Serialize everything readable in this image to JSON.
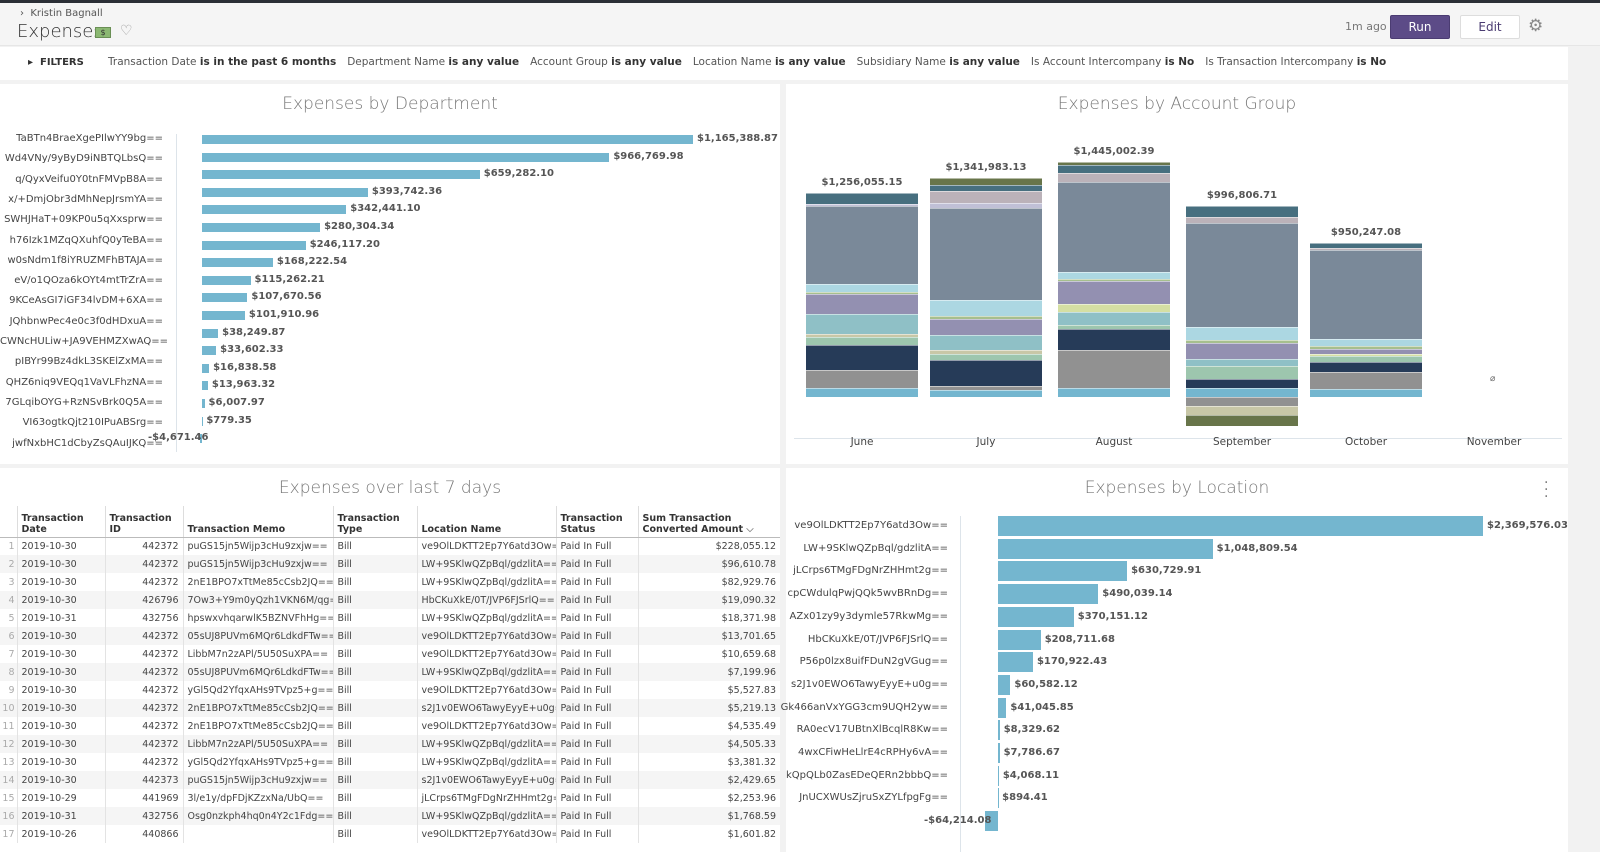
{
  "header": {
    "breadcrumb": "Kristin Bagnall",
    "title": "Expenses",
    "updated": "1m ago",
    "run_label": "Run",
    "edit_label": "Edit",
    "icons": [
      "chevron-right-icon",
      "money-icon",
      "heart-icon",
      "gear-icon"
    ]
  },
  "filters": {
    "label": "FILTERS",
    "items": [
      {
        "field": "Transaction Date",
        "cond": "is in the past 6 months"
      },
      {
        "field": "Department Name",
        "cond": "is any value"
      },
      {
        "field": "Account Group",
        "cond": "is any value"
      },
      {
        "field": "Location Name",
        "cond": "is any value"
      },
      {
        "field": "Subsidiary Name",
        "cond": "is any value"
      },
      {
        "field": "Is Account Intercompany",
        "cond": "is No"
      },
      {
        "field": "Is Transaction Intercompany",
        "cond": "is No"
      }
    ]
  },
  "chart_data": [
    {
      "type": "bar",
      "orientation": "horizontal",
      "title": "Expenses by Department",
      "categories": [
        "TaBTn4BraeXgePIlwYY9bg==",
        "Wd4VNy/9yByD9iNBTQLbsQ==",
        "q/QyxVeifu0Y0tnFMVpB8A==",
        "x/+DmjObr3dMhNepJrsmYA==",
        "SWHJHaT+09KP0u5qXxsprw==",
        "h76Izk1MZqQXuhfQ0yTeBA==",
        "w0sNdm1f8iYRUZMFhBTAJA==",
        "eV/o1QOza6kOYt4mtTrZrA==",
        "9KCeAsGI7iGF34lvDM+6XA==",
        "JQhbnwPec4e0c3f0dHDxuA==",
        "CWNcHULiw+JA9VEHMZXwAQ==",
        "pIBYr99Bz4dkL3SKElZxMA==",
        "QHZ6niq9VEQq1VaVLFhzNA==",
        "7GLqibOYG+RzNSvBrk0Q5A==",
        "VI63ogtkQjt210IPuABSrg==",
        "jwfNxbHC1dCbyZsQAuIJKQ=="
      ],
      "values": [
        1165388.87,
        966769.98,
        659282.1,
        393742.36,
        342441.1,
        280304.34,
        246117.2,
        168222.54,
        115262.21,
        107670.56,
        101910.96,
        38249.87,
        33602.33,
        16838.58,
        13963.32,
        6007.97,
        779.35,
        -4671.46
      ],
      "value_labels": [
        "$1,165,388.87",
        "$966,769.98",
        "$659,282.10",
        "$393,742.36",
        "$342,441.10",
        "$280,304.34",
        "$246,117.20",
        "$168,222.54",
        "$115,262.21",
        "$107,670.56",
        "$101,910.96",
        "$38,249.87",
        "$33,602.33",
        "$16,838.58",
        "$13,963.32",
        "$6,007.97",
        "$779.35",
        "-$4,671.46"
      ],
      "color": "#74b6cf"
    },
    {
      "type": "bar",
      "stacked": true,
      "title": "Expenses by Account Group",
      "categories": [
        "June",
        "July",
        "August",
        "September",
        "October",
        "November"
      ],
      "totals": [
        "$1,256,055.15",
        "$1,341,983.13",
        "$1,445,002.39",
        "$996,806.71",
        "$950,247.08",
        ""
      ],
      "no_data_symbol": "⌀",
      "series": [
        {
          "color": "#74b6cf",
          "values": [
            57000,
            45000,
            57000,
            57000,
            47000,
            0
          ]
        },
        {
          "color": "#919191",
          "values": [
            110000,
            25000,
            229000,
            -57000,
            108000,
            0
          ]
        },
        {
          "color": "#263b58",
          "values": [
            151000,
            159000,
            129000,
            53000,
            57000,
            0
          ]
        },
        {
          "color": "#9dc6ae",
          "values": [
            49000,
            37000,
            29000,
            78000,
            37000,
            0
          ]
        },
        {
          "color": "#c8c7a7",
          "values": [
            16000,
            25000,
            0,
            -55000,
            0,
            0
          ]
        },
        {
          "color": "#8fc0c6",
          "values": [
            123000,
            86000,
            78000,
            47000,
            0,
            0
          ]
        },
        {
          "color": "#d5dfa3",
          "values": [
            0,
            0,
            47000,
            0,
            12000,
            0
          ]
        },
        {
          "color": "#9390b1",
          "values": [
            127000,
            102000,
            143000,
            96000,
            35000,
            0
          ]
        },
        {
          "color": "#a6bf8e",
          "values": [
            8000,
            20000,
            12000,
            20000,
            14000,
            0
          ]
        },
        {
          "color": "#acd7e2",
          "values": [
            49000,
            94000,
            43000,
            80000,
            43000,
            0
          ]
        },
        {
          "color": "#7a8999",
          "values": [
            478000,
            562000,
            551000,
            633000,
            545000,
            0
          ]
        },
        {
          "color": "#c0c0d6",
          "values": [
            16000,
            31000,
            0,
            0,
            0,
            0
          ]
        },
        {
          "color": "#bbb2b9",
          "values": [
            0,
            75000,
            57000,
            39000,
            16000,
            0
          ]
        },
        {
          "color": "#476f7f",
          "values": [
            67000,
            35000,
            45000,
            67000,
            29000,
            0
          ]
        },
        {
          "color": "#68754a",
          "values": [
            0,
            43000,
            20000,
            -65000,
            0,
            0
          ]
        }
      ]
    },
    {
      "type": "bar",
      "orientation": "horizontal",
      "title": "Expenses by Location",
      "categories": [
        "ve9OlLDKTT2Ep7Y6atd3Ow==",
        "LW+9SKlwQZpBql/gdzlitA==",
        "jLCrps6TMgFDgNrZHHmt2g==",
        "cpCWdulqPwjQQk5wvBRnDg==",
        "AZx01zy9y3dymle57RkwMg==",
        "HbCKuXkE/0T/JVP6FJSrlQ==",
        "P56p0lzx8uifFDuN2gVGug==",
        "s2J1v0EWO6TawyEyyE+u0g==",
        "Gk466anVxYGG3cm9UQH2yw==",
        "RA0ecV17UBtnXlBcqlR8Kw==",
        "4wxCFiwHeLlrE4cRPHy6vA==",
        "kQpQLb0ZasEDeQERn2bbbQ==",
        "JnUCXWUsZjruSxZYLfpgFg==",
        ""
      ],
      "values": [
        2369576.03,
        1048809.54,
        630729.91,
        490039.14,
        370151.12,
        208711.68,
        170922.43,
        60582.12,
        41045.85,
        8329.62,
        7786.67,
        4068.11,
        894.41,
        -64214.08
      ],
      "value_labels": [
        "$2,369,576.03",
        "$1,048,809.54",
        "$630,729.91",
        "$490,039.14",
        "$370,151.12",
        "$208,711.68",
        "$170,922.43",
        "$60,582.12",
        "$41,045.85",
        "$8,329.62",
        "$7,786.67",
        "$4,068.11",
        "$894.41",
        "-$64,214.08"
      ],
      "color": "#74b6cf"
    }
  ],
  "table": {
    "title": "Expenses over last 7 days",
    "columns": [
      "Transaction Date",
      "Transaction ID",
      "Transaction Memo",
      "Transaction Type",
      "Location Name",
      "Transaction Status",
      "Sum Transaction Converted Amount"
    ],
    "sort_icon": "chevron-down-icon",
    "rows": [
      [
        "2019-10-30",
        "442372",
        "puGS15jn5Wijp3cHu9zxjw==",
        "Bill",
        "ve9OlLDKTT2Ep7Y6atd3Ow==",
        "Paid In Full",
        "$228,055.12"
      ],
      [
        "2019-10-30",
        "442372",
        "puGS15jn5Wijp3cHu9zxjw==",
        "Bill",
        "LW+9SKlwQZpBql/gdzlitA==",
        "Paid In Full",
        "$96,610.78"
      ],
      [
        "2019-10-30",
        "442372",
        "2nE1BPO7xTtMe85cCsb2JQ==",
        "Bill",
        "LW+9SKlwQZpBql/gdzlitA==",
        "Paid In Full",
        "$82,929.76"
      ],
      [
        "2019-10-30",
        "426796",
        "7Ow3+Y9m0yQzh1VKN6M/qg==",
        "Bill",
        "HbCKuXkE/0T/JVP6FJSrlQ==",
        "Paid In Full",
        "$19,090.32"
      ],
      [
        "2019-10-31",
        "432756",
        "hpswxvhqarwlK5BZNVFhHg==",
        "Bill",
        "LW+9SKlwQZpBql/gdzlitA==",
        "Paid In Full",
        "$18,371.98"
      ],
      [
        "2019-10-30",
        "442372",
        "05sUJ8PUVm6MQr6LdkdFTw==",
        "Bill",
        "ve9OlLDKTT2Ep7Y6atd3Ow==",
        "Paid In Full",
        "$13,701.65"
      ],
      [
        "2019-10-30",
        "442372",
        "LibbM7n2zAPl/5U50SuXPA==",
        "Bill",
        "ve9OlLDKTT2Ep7Y6atd3Ow==",
        "Paid In Full",
        "$10,659.68"
      ],
      [
        "2019-10-30",
        "442372",
        "05sUJ8PUVm6MQr6LdkdFTw==",
        "Bill",
        "LW+9SKlwQZpBql/gdzlitA==",
        "Paid In Full",
        "$7,199.96"
      ],
      [
        "2019-10-30",
        "442372",
        "yGl5Qd2YfqxAHs9TVpz5+g==",
        "Bill",
        "ve9OlLDKTT2Ep7Y6atd3Ow==",
        "Paid In Full",
        "$5,527.83"
      ],
      [
        "2019-10-30",
        "442372",
        "2nE1BPO7xTtMe85cCsb2JQ==",
        "Bill",
        "s2J1v0EWO6TawyEyyE+u0g==",
        "Paid In Full",
        "$5,219.13"
      ],
      [
        "2019-10-30",
        "442372",
        "2nE1BPO7xTtMe85cCsb2JQ==",
        "Bill",
        "ve9OlLDKTT2Ep7Y6atd3Ow==",
        "Paid In Full",
        "$4,535.49"
      ],
      [
        "2019-10-30",
        "442372",
        "LibbM7n2zAPl/5U50SuXPA==",
        "Bill",
        "LW+9SKlwQZpBql/gdzlitA==",
        "Paid In Full",
        "$4,505.33"
      ],
      [
        "2019-10-30",
        "442372",
        "yGl5Qd2YfqxAHs9TVpz5+g==",
        "Bill",
        "LW+9SKlwQZpBql/gdzlitA==",
        "Paid In Full",
        "$3,381.32"
      ],
      [
        "2019-10-30",
        "442373",
        "puGS15jn5Wijp3cHu9zxjw==",
        "Bill",
        "s2J1v0EWO6TawyEyyE+u0g==",
        "Paid In Full",
        "$2,429.65"
      ],
      [
        "2019-10-29",
        "441969",
        "3l/e1y/dpFDjKZzxNa/UbQ==",
        "Bill",
        "jLCrps6TMgFDgNrZHHmt2g==",
        "Paid In Full",
        "$2,253.96"
      ],
      [
        "2019-10-31",
        "432756",
        "Osg0nzkph4hq0n4Y2c1Fdg==",
        "Bill",
        "LW+9SKlwQZpBql/gdzlitA==",
        "Paid In Full",
        "$1,768.59"
      ],
      [
        "2019-10-26",
        "440866",
        "",
        "Bill",
        "ve9OlLDKTT2Ep7Y6atd3Ow==",
        "Paid In Full",
        "$1,601.82"
      ]
    ]
  }
}
